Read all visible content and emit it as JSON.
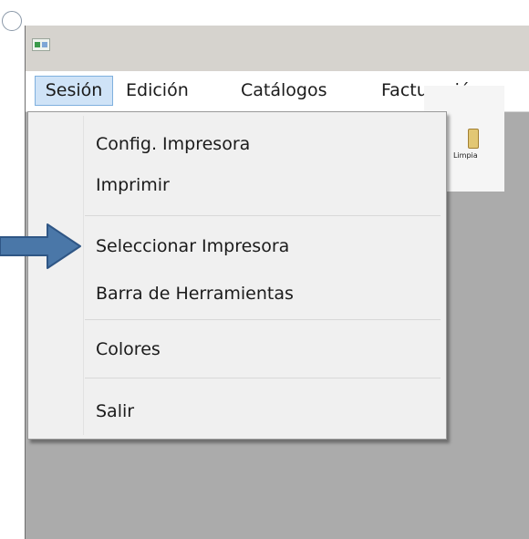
{
  "menubar": {
    "items": [
      {
        "label": "Sesión"
      },
      {
        "label": "Edición"
      },
      {
        "label": "Catálogos"
      },
      {
        "label": "Facturación"
      }
    ]
  },
  "toolbar": {
    "partial_label": "Limpia"
  },
  "dropdown": {
    "items": [
      {
        "label": "Config. Impresora"
      },
      {
        "label": "Imprimir"
      },
      {
        "label": "Seleccionar Impresora"
      },
      {
        "label": "Barra de Herramientas"
      },
      {
        "label": "Colores"
      },
      {
        "label": "Salir"
      }
    ]
  },
  "colors": {
    "arrow": "#4a77a8",
    "menu_highlight": "#cfe3f7",
    "client_area": "#ababab"
  }
}
